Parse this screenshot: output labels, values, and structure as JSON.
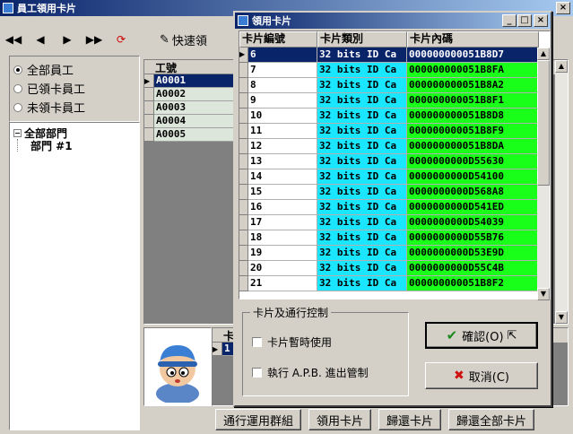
{
  "main": {
    "title": "員工領用卡片",
    "quick_label": "快速領",
    "filters": [
      "全部員工",
      "已領卡員工",
      "未領卡員工"
    ],
    "tree_root": "全部部門",
    "tree_child": "部門 #1",
    "grid_header": "工號",
    "employees": [
      "A0001",
      "A0002",
      "A0003",
      "A0004",
      "A0005"
    ],
    "lower_grid_header": "卡",
    "lower_grid_row": "1",
    "buttons": [
      "通行運用群組",
      "領用卡片",
      "歸還卡片",
      "歸還全部卡片"
    ]
  },
  "dialog": {
    "title": "領用卡片",
    "columns": [
      "卡片編號",
      "卡片類別",
      "卡片內碼"
    ],
    "rows": [
      [
        "6",
        "32 bits ID Ca",
        "000000000051B8D7"
      ],
      [
        "7",
        "32 bits ID Ca",
        "000000000051B8FA"
      ],
      [
        "8",
        "32 bits ID Ca",
        "000000000051B8A2"
      ],
      [
        "9",
        "32 bits ID Ca",
        "000000000051B8F1"
      ],
      [
        "10",
        "32 bits ID Ca",
        "000000000051B8D8"
      ],
      [
        "11",
        "32 bits ID Ca",
        "000000000051B8F9"
      ],
      [
        "12",
        "32 bits ID Ca",
        "000000000051B8DA"
      ],
      [
        "13",
        "32 bits ID Ca",
        "0000000000D55630"
      ],
      [
        "14",
        "32 bits ID Ca",
        "0000000000D54100"
      ],
      [
        "15",
        "32 bits ID Ca",
        "0000000000D568A8"
      ],
      [
        "16",
        "32 bits ID Ca",
        "0000000000D541ED"
      ],
      [
        "17",
        "32 bits ID Ca",
        "0000000000D54039"
      ],
      [
        "18",
        "32 bits ID Ca",
        "0000000000D55B76"
      ],
      [
        "19",
        "32 bits ID Ca",
        "0000000000D53E9D"
      ],
      [
        "20",
        "32 bits ID Ca",
        "0000000000D55C4B"
      ],
      [
        "21",
        "32 bits ID Ca",
        "000000000051B8F2"
      ]
    ],
    "group_label": "卡片及通行控制",
    "check_temp": "卡片暫時使用",
    "check_apb": "執行 A.P.B. 進出管制",
    "confirm": "確認(O)",
    "cancel": "取消(C)"
  }
}
